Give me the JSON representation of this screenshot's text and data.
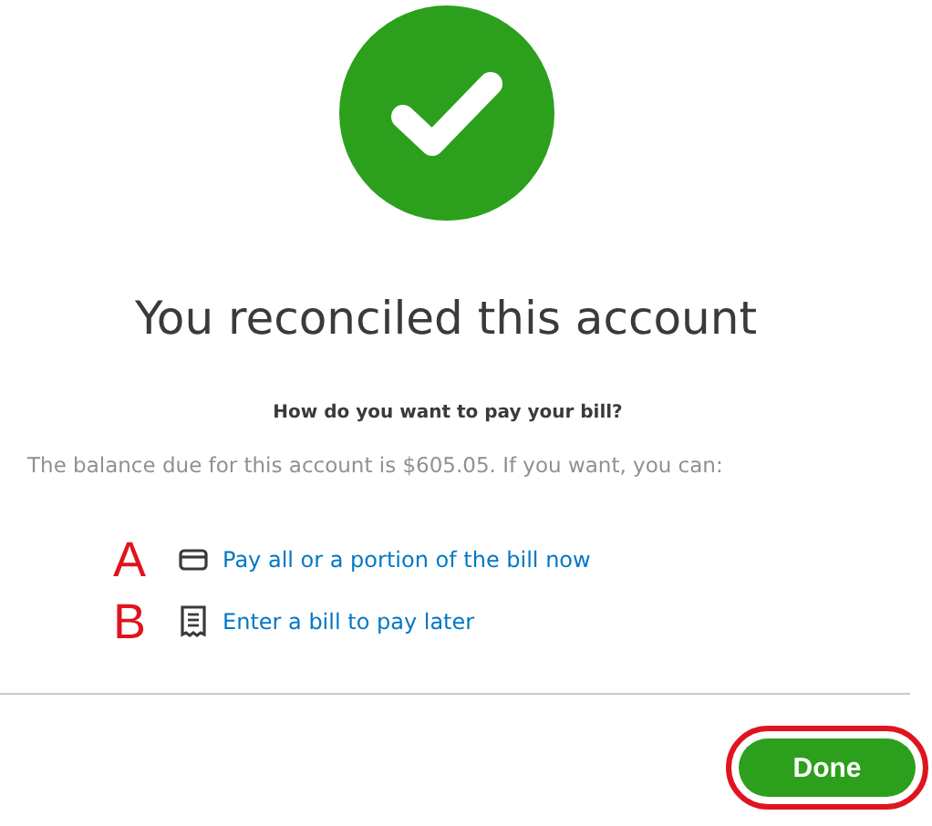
{
  "title": "You reconciled this account",
  "question": "How do you want to pay your bill?",
  "balance_text": "The balance due for this account is $605.05. If you want, you can:",
  "options": [
    {
      "marker": "A",
      "kind": "card",
      "label": "Pay all or a portion of the bill now"
    },
    {
      "marker": "B",
      "kind": "receipt",
      "label": "Enter a bill to pay later"
    }
  ],
  "done_button": {
    "label": "Done",
    "highlighted": true
  }
}
